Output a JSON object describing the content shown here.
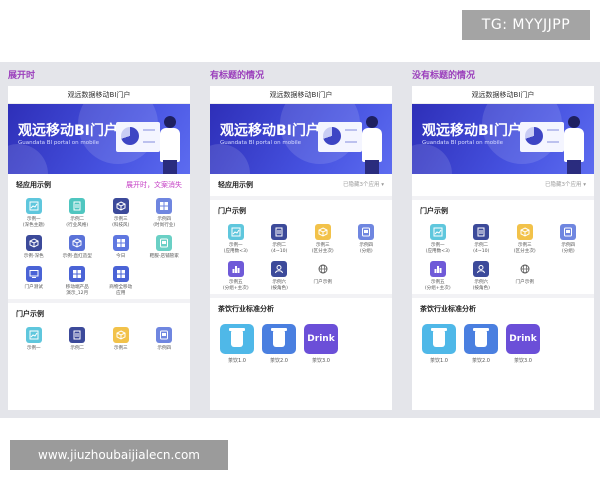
{
  "watermarks": {
    "tg": "TG: MYYJJPP",
    "url": "www.jiuzhoubaijialecn.com"
  },
  "colors": {
    "section_title": "#9b3fbc",
    "banner": "#3b44cc",
    "accent_pink": "#c43cc4"
  },
  "section_titles": [
    "展开时",
    "有标题的情况",
    "没有标题的情况"
  ],
  "phone_title": "观远数据移动BI门户",
  "banner": {
    "title": "观远移动BI门户",
    "subtitle": "Guandata BI portal on mobile"
  },
  "phones": [
    {
      "groups": [
        {
          "title": "轻应用示例",
          "right": "展开时，文案消失",
          "items": [
            {
              "label": "示例一\n(深色主题)",
              "color": "#5fc7dd",
              "icon": "chart-icon"
            },
            {
              "label": "示例二\n(行业风格)",
              "color": "#4fc6c0",
              "icon": "doc-icon"
            },
            {
              "label": "示例三\n(科技风)",
              "color": "#3c4a9a",
              "icon": "cube-icon"
            },
            {
              "label": "示例四\n(时尚行业)",
              "color": "#6f86e0",
              "icon": "grid-icon"
            },
            {
              "label": "示例-深色",
              "color": "#3c4a9a",
              "icon": "cube-icon"
            },
            {
              "label": "示例-直红造型",
              "color": "#5a72d8",
              "icon": "cube-icon"
            },
            {
              "label": "今日",
              "color": "#5f77e0",
              "icon": "grid-icon"
            },
            {
              "label": "鞋服-店铺管家",
              "color": "#6ad0c5",
              "icon": "card-icon"
            },
            {
              "label": "门户测试",
              "color": "#4a63d6",
              "icon": "monitor-icon"
            },
            {
              "label": "移动端产品\n演示_12月",
              "color": "#4a63d6",
              "icon": "grid-icon"
            },
            {
              "label": "商物全移动\n应用",
              "color": "#4a63d6",
              "icon": "grid-icon"
            }
          ]
        },
        {
          "title": "门户示例",
          "right": "",
          "items": [
            {
              "label": "示例一",
              "color": "#5fc7dd",
              "icon": "chart-icon"
            },
            {
              "label": "示例二",
              "color": "#3c4a9a",
              "icon": "doc-icon"
            },
            {
              "label": "示例三",
              "color": "#f2c24a",
              "icon": "cube-icon"
            },
            {
              "label": "示例四",
              "color": "#6f86e0",
              "icon": "card-icon"
            }
          ]
        }
      ],
      "tea": null
    },
    {
      "groups": [
        {
          "title": "轻应用示例",
          "right": "已隐藏3个应用 ▾",
          "items": []
        },
        {
          "title": "门户示例",
          "right": "",
          "items": [
            {
              "label": "示例一\n(应用数<3)",
              "color": "#5fc7dd",
              "icon": "chart-icon"
            },
            {
              "label": "示例二\n(4~10)",
              "color": "#3c4a9a",
              "icon": "doc-icon"
            },
            {
              "label": "示例三\n(区分主次)",
              "color": "#f2c24a",
              "icon": "cube-icon"
            },
            {
              "label": "示例四\n(分组)",
              "color": "#6f86e0",
              "icon": "card-icon"
            },
            {
              "label": "示例五\n(分组+主次)",
              "color": "#6f5ad8",
              "icon": "bars-icon"
            },
            {
              "label": "示例六\n(按角色)",
              "color": "#3c4a9a",
              "icon": "user-icon"
            },
            {
              "label": "门户示例",
              "color": "outline",
              "icon": "globe-icon"
            }
          ]
        }
      ],
      "tea": {
        "title": "茶饮行业标准分析",
        "items": [
          {
            "label": "茶饮1.0",
            "color": "#4fb8e8",
            "text": ""
          },
          {
            "label": "茶饮2.0",
            "color": "#4a7fe0",
            "text": ""
          },
          {
            "label": "茶饮3.0",
            "color": "#6b4fd8",
            "text": "Drink"
          }
        ]
      }
    },
    {
      "groups": [
        {
          "title": "",
          "right": "已隐藏3个应用 ▾",
          "items": []
        },
        {
          "title": "门户示例",
          "right": "",
          "items": [
            {
              "label": "示例一\n(应用数<3)",
              "color": "#5fc7dd",
              "icon": "chart-icon"
            },
            {
              "label": "示例二\n(4~10)",
              "color": "#3c4a9a",
              "icon": "doc-icon"
            },
            {
              "label": "示例三\n(区分主次)",
              "color": "#f2c24a",
              "icon": "cube-icon"
            },
            {
              "label": "示例四\n(分组)",
              "color": "#6f86e0",
              "icon": "card-icon"
            },
            {
              "label": "示例五\n(分组+主次)",
              "color": "#6f5ad8",
              "icon": "bars-icon"
            },
            {
              "label": "示例六\n(按角色)",
              "color": "#3c4a9a",
              "icon": "user-icon"
            },
            {
              "label": "门户示例",
              "color": "outline",
              "icon": "globe-icon"
            }
          ]
        }
      ],
      "tea": {
        "title": "茶饮行业标准分析",
        "items": [
          {
            "label": "茶饮1.0",
            "color": "#4fb8e8",
            "text": ""
          },
          {
            "label": "茶饮2.0",
            "color": "#4a7fe0",
            "text": ""
          },
          {
            "label": "茶饮3.0",
            "color": "#6b4fd8",
            "text": "Drink"
          }
        ]
      }
    }
  ]
}
